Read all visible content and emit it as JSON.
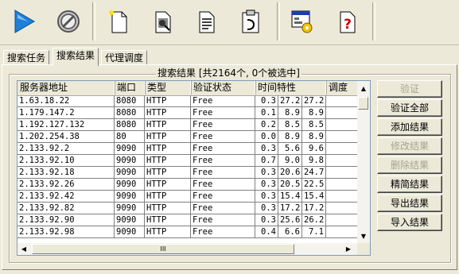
{
  "toolbar": {
    "buttons": [
      {
        "name": "start-search",
        "icon": "play-triangle-icon"
      },
      {
        "name": "stop",
        "icon": "stop-sign-icon"
      },
      {
        "name": "new",
        "icon": "new-document-icon"
      },
      {
        "name": "search",
        "icon": "search-document-icon"
      },
      {
        "name": "document",
        "icon": "text-document-icon"
      },
      {
        "name": "clipboard",
        "icon": "clipboard-icon"
      },
      {
        "name": "settings",
        "icon": "settings-window-icon"
      },
      {
        "name": "help",
        "icon": "help-question-icon"
      }
    ]
  },
  "tabs": [
    {
      "label": "搜索任务"
    },
    {
      "label": "搜索结果"
    },
    {
      "label": "代理调度"
    }
  ],
  "group": {
    "title": "搜索结果 [共2164个, 0个被选中]"
  },
  "table": {
    "headers": [
      "服务器地址",
      "端口",
      "类型",
      "验证状态",
      "时间特性",
      "调度"
    ],
    "rows": [
      {
        "ip": "1.63.18.22",
        "port": "8080",
        "type": "HTTP",
        "status": "Free",
        "t1": "0.3",
        "t2": "27.2",
        "t3": "27.2"
      },
      {
        "ip": "1.179.147.2",
        "port": "8080",
        "type": "HTTP",
        "status": "Free",
        "t1": "0.1",
        "t2": "8.9",
        "t3": "8.9"
      },
      {
        "ip": "1.192.127.132",
        "port": "8080",
        "type": "HTTP",
        "status": "Free",
        "t1": "0.2",
        "t2": "8.5",
        "t3": "8.5"
      },
      {
        "ip": "1.202.254.38",
        "port": "80",
        "type": "HTTP",
        "status": "Free",
        "t1": "0.0",
        "t2": "8.9",
        "t3": "8.9"
      },
      {
        "ip": "2.133.92.2",
        "port": "9090",
        "type": "HTTP",
        "status": "Free",
        "t1": "0.3",
        "t2": "5.6",
        "t3": "9.6"
      },
      {
        "ip": "2.133.92.10",
        "port": "9090",
        "type": "HTTP",
        "status": "Free",
        "t1": "0.7",
        "t2": "9.0",
        "t3": "9.8"
      },
      {
        "ip": "2.133.92.18",
        "port": "9090",
        "type": "HTTP",
        "status": "Free",
        "t1": "0.3",
        "t2": "20.6",
        "t3": "24.7"
      },
      {
        "ip": "2.133.92.26",
        "port": "9090",
        "type": "HTTP",
        "status": "Free",
        "t1": "0.3",
        "t2": "20.5",
        "t3": "22.5"
      },
      {
        "ip": "2.133.92.42",
        "port": "9090",
        "type": "HTTP",
        "status": "Free",
        "t1": "0.3",
        "t2": "15.4",
        "t3": "15.4"
      },
      {
        "ip": "2.133.92.82",
        "port": "9090",
        "type": "HTTP",
        "status": "Free",
        "t1": "0.3",
        "t2": "17.2",
        "t3": "17.2"
      },
      {
        "ip": "2.133.92.90",
        "port": "9090",
        "type": "HTTP",
        "status": "Free",
        "t1": "0.3",
        "t2": "25.6",
        "t3": "26.2"
      },
      {
        "ip": "2.133.92.98",
        "port": "9090",
        "type": "HTTP",
        "status": "Free",
        "t1": "0.4",
        "t2": "6.6",
        "t3": "7.1"
      }
    ]
  },
  "actions": [
    {
      "label": "验证",
      "disabled": true
    },
    {
      "label": "验证全部",
      "disabled": false
    },
    {
      "label": "添加结果",
      "disabled": false
    },
    {
      "label": "修改结果",
      "disabled": true
    },
    {
      "label": "删除结果",
      "disabled": true
    },
    {
      "label": "精简结果",
      "disabled": false
    },
    {
      "label": "导出结果",
      "disabled": false
    },
    {
      "label": "导入结果",
      "disabled": false
    }
  ],
  "scrollbar": {
    "thumb_grip": "III"
  },
  "colors": {
    "play": "#1e7fd8",
    "help": "#cc0000",
    "disabled_text": "#a7a391"
  }
}
